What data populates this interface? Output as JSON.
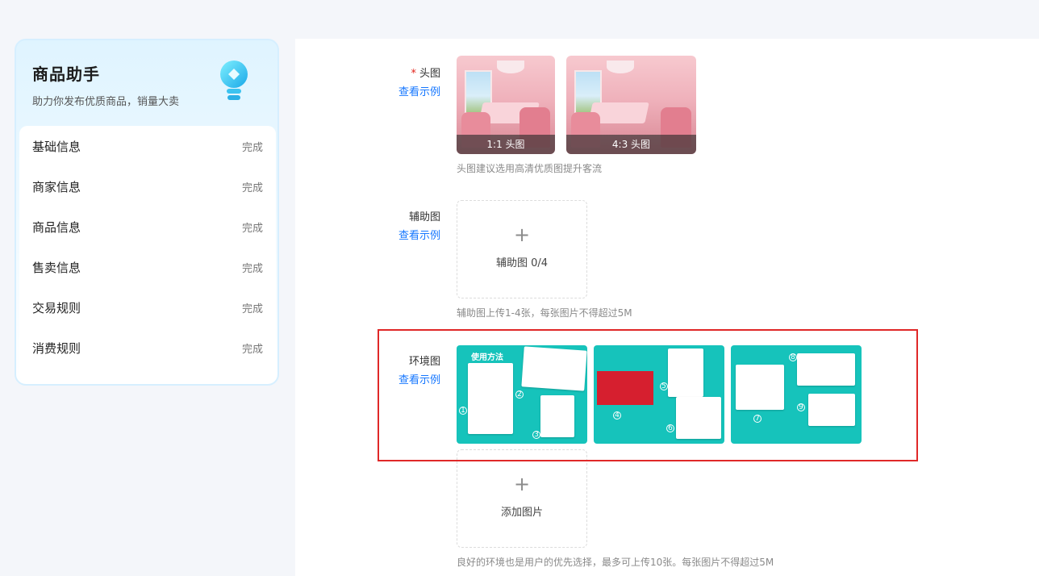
{
  "sidebar": {
    "title": "商品助手",
    "subtitle": "助力你发布优质商品，销量大卖",
    "steps": [
      {
        "name": "基础信息",
        "status": "完成"
      },
      {
        "name": "商家信息",
        "status": "完成"
      },
      {
        "name": "商品信息",
        "status": "完成"
      },
      {
        "name": "售卖信息",
        "status": "完成"
      },
      {
        "name": "交易规则",
        "status": "完成"
      },
      {
        "name": "消费规则",
        "status": "完成"
      }
    ]
  },
  "head_image": {
    "required_mark": "*",
    "label": "头图",
    "example_link": "查看示例",
    "thumbs": [
      {
        "caption": "1:1 头图"
      },
      {
        "caption": "4:3 头图"
      }
    ],
    "hint": "头图建议选用高清优质图提升客流"
  },
  "aux_image": {
    "label": "辅助图",
    "example_link": "查看示例",
    "upload_plus": "+",
    "upload_text": "辅助图 0/4",
    "hint": "辅助图上传1-4张，每张图片不得超过5M"
  },
  "env_image": {
    "label": "环境图",
    "example_link": "查看示例",
    "guide_title": "使用方法",
    "upload_plus": "+",
    "upload_text": "添加图片",
    "hint": "良好的环境也是用户的优先选择，最多可上传10张。每张图片不得超过5M"
  },
  "colors": {
    "accent": "#1677ff",
    "required": "#e2231a",
    "highlight": "#e02828",
    "env_bg": "#16c3bb"
  }
}
